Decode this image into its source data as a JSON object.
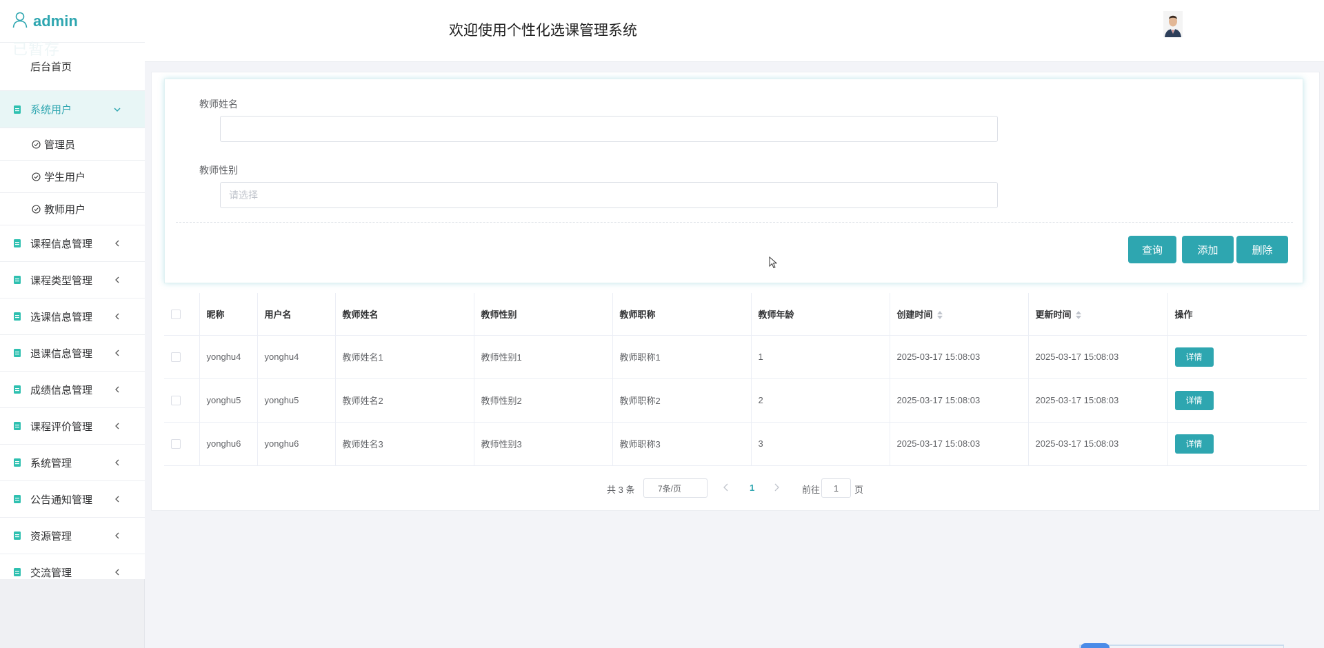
{
  "sidebar": {
    "user_name": "admin",
    "faded_text": "已暂存",
    "home_label": "后台首页",
    "system_users": {
      "label": "系统用户",
      "children": [
        "管理员",
        "学生用户",
        "教师用户"
      ]
    },
    "menu": [
      "课程信息管理",
      "课程类型管理",
      "选课信息管理",
      "退课信息管理",
      "成绩信息管理",
      "课程评价管理",
      "系统管理",
      "公告通知管理",
      "资源管理",
      "交流管理"
    ]
  },
  "header": {
    "title": "欢迎使用个性化选课管理系统"
  },
  "search": {
    "name_label": "教师姓名",
    "name_value": "",
    "gender_label": "教师性别",
    "gender_placeholder": "请选择",
    "query_label": "查询",
    "add_label": "添加",
    "delete_label": "删除"
  },
  "table": {
    "headers": [
      "昵称",
      "用户名",
      "教师姓名",
      "教师性别",
      "教师职称",
      "教师年龄",
      "创建时间",
      "更新时间",
      "操作"
    ],
    "rows": [
      {
        "nickname": "yonghu4",
        "username": "yonghu4",
        "name": "教师姓名1",
        "gender": "教师性别1",
        "title": "教师职称1",
        "age": "1",
        "created": "2025-03-17 15:08:03",
        "updated": "2025-03-17 15:08:03",
        "action": "详情"
      },
      {
        "nickname": "yonghu5",
        "username": "yonghu5",
        "name": "教师姓名2",
        "gender": "教师性别2",
        "title": "教师职称2",
        "age": "2",
        "created": "2025-03-17 15:08:03",
        "updated": "2025-03-17 15:08:03",
        "action": "详情"
      },
      {
        "nickname": "yonghu6",
        "username": "yonghu6",
        "name": "教师姓名3",
        "gender": "教师性别3",
        "title": "教师职称3",
        "age": "3",
        "created": "2025-03-17 15:08:03",
        "updated": "2025-03-17 15:08:03",
        "action": "详情"
      }
    ]
  },
  "pagination": {
    "total": "共 3 条",
    "page_size": "7条/页",
    "current_page": "1",
    "goto_label": "前往",
    "goto_value": "1",
    "page_suffix": "页"
  },
  "colors": {
    "accent": "#2ea6b0",
    "sidebar_active_bg": "#e8f6f6",
    "page_bg": "#f3f4f8"
  }
}
